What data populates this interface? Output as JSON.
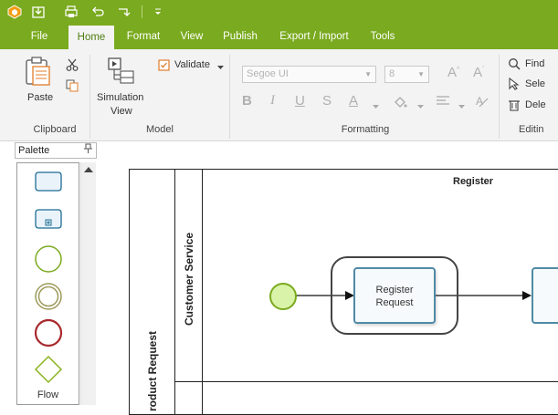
{
  "tabs": {
    "file": "File",
    "home": "Home",
    "format": "Format",
    "view": "View",
    "publish": "Publish",
    "export_import": "Export / Import",
    "tools": "Tools"
  },
  "ribbon": {
    "paste": "Paste",
    "simulation_view_1": "Simulation",
    "simulation_view_2": "View",
    "validate": "Validate",
    "font_name": "Segoe UI",
    "font_size": "8",
    "find": "Find",
    "select": "Sele",
    "delete": "Dele",
    "groups": {
      "clipboard": "Clipboard",
      "model": "Model",
      "formatting": "Formatting",
      "editing": "Editin"
    }
  },
  "palette": {
    "title": "Palette",
    "pin_icon": "pin-icon",
    "flow_label": "Flow"
  },
  "diagram": {
    "pool_title": "Register",
    "lane_customer_service": "Customer Service",
    "pool_product_request": "roduct Request",
    "task_label_line1": "Register",
    "task_label_line2": "Request"
  },
  "colors": {
    "accent_green": "#7aaa1f",
    "start_event_fill": "#d9f3a8",
    "task_border": "#4f8aa5",
    "task_fill": "#f6fafc"
  }
}
